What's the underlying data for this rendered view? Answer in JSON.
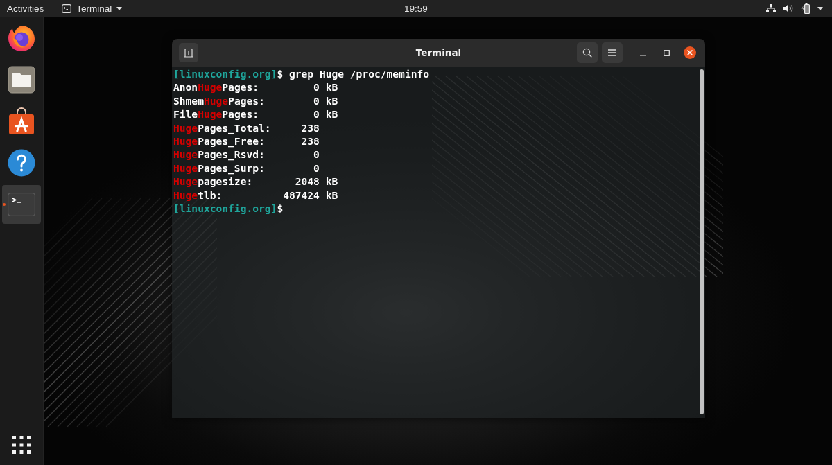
{
  "top_bar": {
    "activities": "Activities",
    "app_menu": "Terminal",
    "clock": "19:59"
  },
  "dock": {
    "items": [
      {
        "kind": "browser",
        "selected": false,
        "running": false
      },
      {
        "kind": "files",
        "selected": false,
        "running": false
      },
      {
        "kind": "software",
        "selected": false,
        "running": false
      },
      {
        "kind": "help",
        "selected": false,
        "running": false
      },
      {
        "kind": "terminal",
        "selected": true,
        "running": true
      }
    ]
  },
  "window": {
    "title": "Terminal",
    "lines": [
      {
        "segments": [
          {
            "kind": "prompt",
            "text": "[linuxconfig.org]"
          },
          {
            "kind": "plain",
            "text": "$ grep Huge /proc/meminfo"
          }
        ]
      },
      {
        "segments": [
          {
            "kind": "plain",
            "text": "Anon"
          },
          {
            "kind": "match",
            "text": "Huge"
          },
          {
            "kind": "plain",
            "text": "Pages:         0 kB"
          }
        ]
      },
      {
        "segments": [
          {
            "kind": "plain",
            "text": "Shmem"
          },
          {
            "kind": "match",
            "text": "Huge"
          },
          {
            "kind": "plain",
            "text": "Pages:        0 kB"
          }
        ]
      },
      {
        "segments": [
          {
            "kind": "plain",
            "text": "File"
          },
          {
            "kind": "match",
            "text": "Huge"
          },
          {
            "kind": "plain",
            "text": "Pages:         0 kB"
          }
        ]
      },
      {
        "segments": [
          {
            "kind": "match",
            "text": "Huge"
          },
          {
            "kind": "plain",
            "text": "Pages_Total:     238"
          }
        ]
      },
      {
        "segments": [
          {
            "kind": "match",
            "text": "Huge"
          },
          {
            "kind": "plain",
            "text": "Pages_Free:      238"
          }
        ]
      },
      {
        "segments": [
          {
            "kind": "match",
            "text": "Huge"
          },
          {
            "kind": "plain",
            "text": "Pages_Rsvd:        0"
          }
        ]
      },
      {
        "segments": [
          {
            "kind": "match",
            "text": "Huge"
          },
          {
            "kind": "plain",
            "text": "Pages_Surp:        0"
          }
        ]
      },
      {
        "segments": [
          {
            "kind": "match",
            "text": "Huge"
          },
          {
            "kind": "plain",
            "text": "pagesize:       2048 kB"
          }
        ]
      },
      {
        "segments": [
          {
            "kind": "match",
            "text": "Huge"
          },
          {
            "kind": "plain",
            "text": "tlb:          487424 kB"
          }
        ]
      },
      {
        "segments": [
          {
            "kind": "prompt",
            "text": "[linuxconfig.org]"
          },
          {
            "kind": "plain",
            "text": "$"
          }
        ]
      }
    ]
  }
}
